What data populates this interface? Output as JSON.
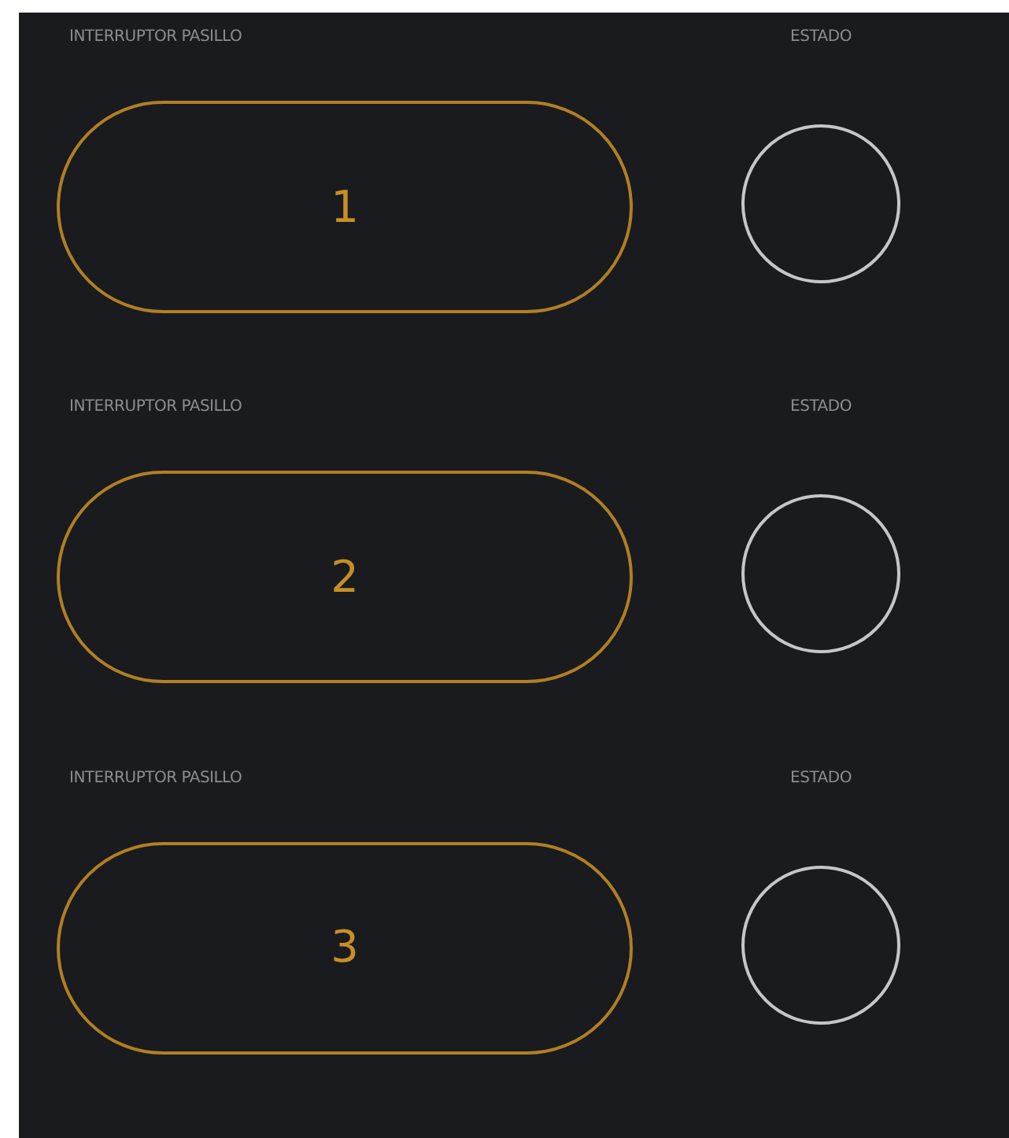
{
  "switches": [
    {
      "label": "INTERRUPTOR PASILLO",
      "button": "1",
      "status_label": "ESTADO",
      "on": false
    },
    {
      "label": "INTERRUPTOR PASILLO",
      "button": "2",
      "status_label": "ESTADO",
      "on": false
    },
    {
      "label": "INTERRUPTOR PASILLO",
      "button": "3",
      "status_label": "ESTADO",
      "on": false
    }
  ]
}
